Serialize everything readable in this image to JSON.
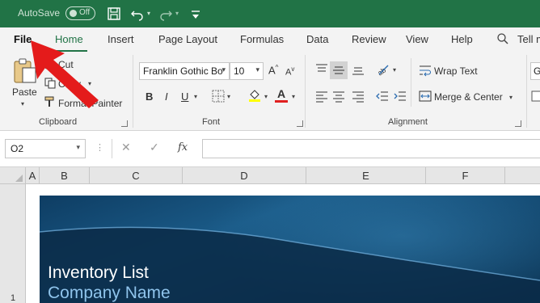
{
  "titlebar": {
    "autosave_label": "AutoSave",
    "toggle_state": "Off",
    "icons": [
      "save-icon",
      "undo-icon",
      "redo-icon",
      "customize-qat-icon"
    ]
  },
  "ribbon_tabs": {
    "items": [
      "File",
      "Home",
      "Insert",
      "Page Layout",
      "Formulas",
      "Data",
      "Review",
      "View",
      "Help",
      "Tell m"
    ],
    "active": "Home"
  },
  "clipboard": {
    "paste": "Paste",
    "cut": "Cut",
    "copy": "Copy",
    "format_painter": "Format Painter",
    "group_label": "Clipboard"
  },
  "font": {
    "font_name": "Franklin Gothic Bo",
    "font_size": "10",
    "bold": "B",
    "italic": "I",
    "underline": "U",
    "font_color_glyph": "A",
    "grow_glyph": "A",
    "shrink_glyph": "A",
    "grow_sup": "^",
    "shrink_sup": "v",
    "group_label": "Font"
  },
  "alignment": {
    "wrap_text": "Wrap Text",
    "merge_center": "Merge & Center",
    "group_label": "Alignment",
    "cut_off_combo": "G"
  },
  "formula_bar": {
    "name_box": "O2",
    "fx_label": "fx",
    "formula": ""
  },
  "columns": [
    "A",
    "B",
    "C",
    "D",
    "E",
    "F"
  ],
  "rows": [
    "1"
  ],
  "sheet": {
    "title": "Inventory List",
    "company": "Company Name"
  },
  "colors": {
    "accent": "#217346",
    "pointer": "#e41b1b",
    "banner": "#134a73",
    "company_text": "#8fc4ec"
  }
}
